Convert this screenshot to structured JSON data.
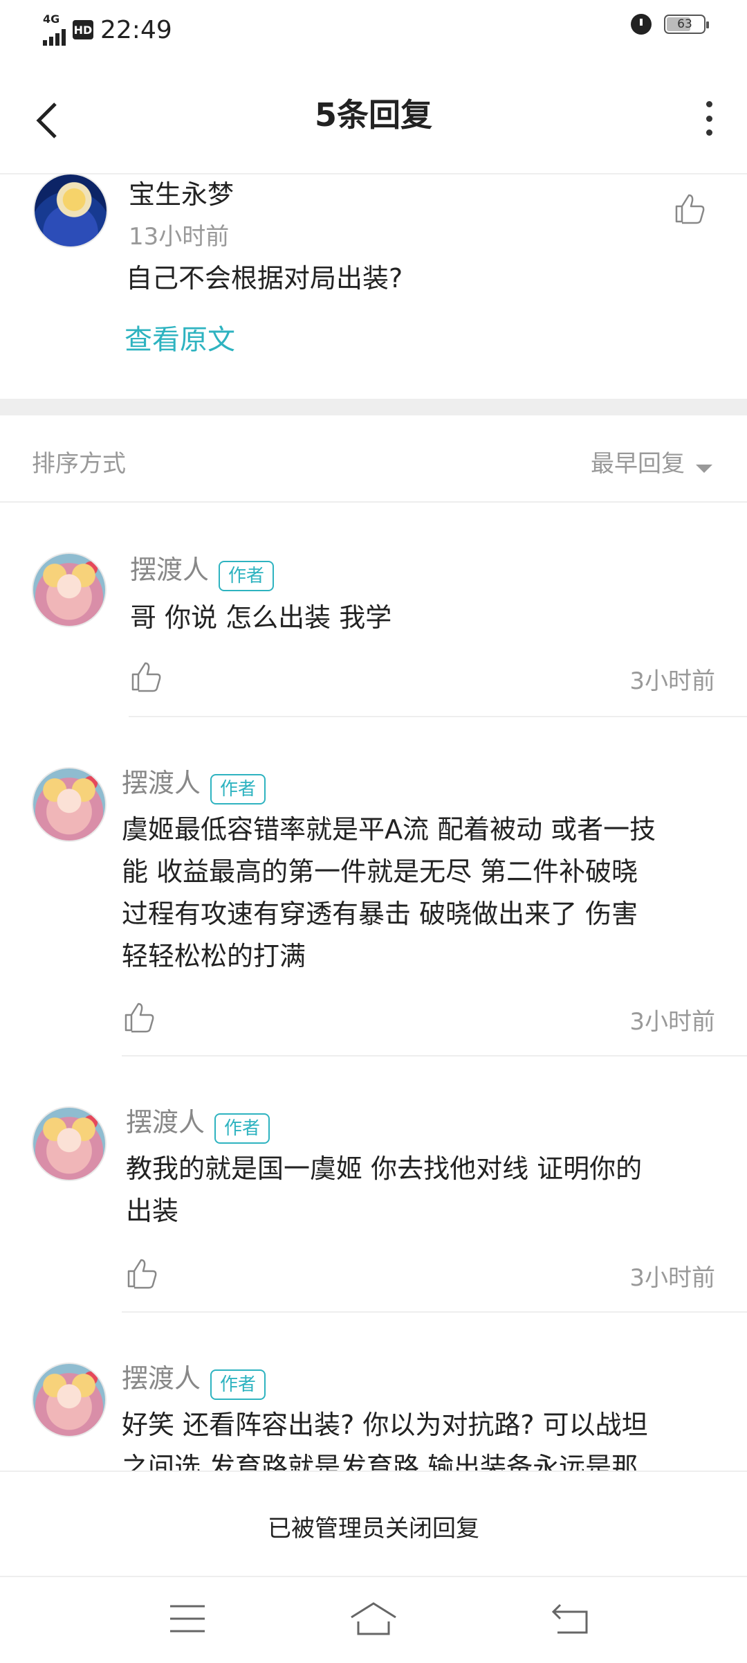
{
  "status_bar": {
    "network": "4G",
    "hd": "HD",
    "time": "22:49",
    "battery": "63"
  },
  "header": {
    "title": "5条回复"
  },
  "original_post": {
    "username": "宝生永梦",
    "time": "13小时前",
    "text": "自己不会根据对局出装?",
    "view_original": "查看原文"
  },
  "sort": {
    "label": "排序方式",
    "value": "最早回复"
  },
  "replies": [
    {
      "username": "摆渡人",
      "tag": "作者",
      "text": "哥 你说 怎么出装 我学",
      "time": "3小时前"
    },
    {
      "username": "摆渡人",
      "tag": "作者",
      "lines": [
        "虞姬最低容错率就是平A流 配着被动 或者一技",
        "能 收益最高的第一件就是无尽 第二件补破晓",
        "过程有攻速有穿透有暴击 破晓做出来了 伤害",
        "轻轻松松的打满"
      ],
      "time": "3小时前"
    },
    {
      "username": "摆渡人",
      "tag": "作者",
      "lines": [
        "教我的就是国一虞姬 你去找他对线 证明你的",
        "出装"
      ],
      "time": "3小时前"
    },
    {
      "username": "摆渡人",
      "tag": "作者",
      "lines": [
        "好笑 还看阵容出装? 你以为对抗路? 可以战坦",
        "之间选 发育路就是发育路 输出装备永远是那"
      ]
    }
  ],
  "footer": {
    "closed_notice": "已被管理员关闭回复"
  },
  "colors": {
    "accent": "#2eb3c0",
    "divider": "#eeeeee",
    "secondary_text": "#999999"
  }
}
